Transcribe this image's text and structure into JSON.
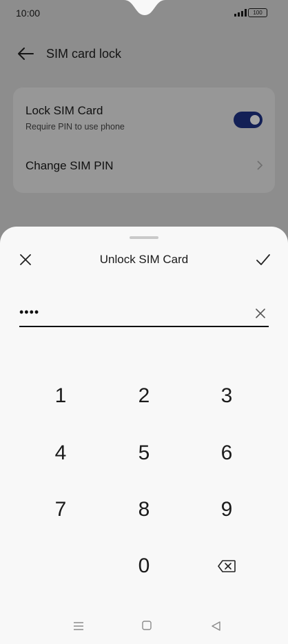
{
  "status": {
    "time": "10:00",
    "battery": "100"
  },
  "settings": {
    "title": "SIM card lock",
    "lock_title": "Lock SIM Card",
    "lock_subtitle": "Require PIN to use phone",
    "lock_enabled": true,
    "change_pin": "Change SIM PIN"
  },
  "sheet": {
    "title": "Unlock SIM Card",
    "pin_masked": "••••"
  },
  "keypad": {
    "k1": "1",
    "k2": "2",
    "k3": "3",
    "k4": "4",
    "k5": "5",
    "k6": "6",
    "k7": "7",
    "k8": "8",
    "k9": "9",
    "k0": "0"
  },
  "colors": {
    "toggle_on": "#1d2f8a",
    "sheet_bg": "#f8f8f8"
  }
}
